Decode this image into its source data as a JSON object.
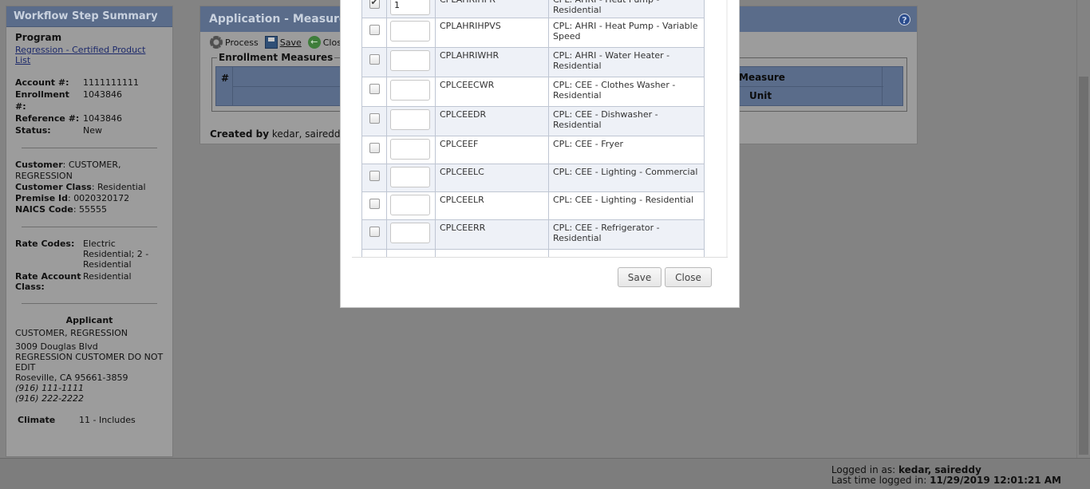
{
  "left_panel": {
    "title": "Workflow Step Summary",
    "program_label": "Program",
    "program_link": "Regression - Certified Product List",
    "account_label": "Account #:",
    "account_value": "1111111111",
    "enrollment_label": "Enrollment #:",
    "enrollment_value": "1043846",
    "reference_label": "Reference #:",
    "reference_value": "1043846",
    "status_label": "Status:",
    "status_value": "New",
    "customer_label": "Customer",
    "customer_value": "CUSTOMER, REGRESSION",
    "customer_class_label": "Customer Class",
    "customer_class_value": "Residential",
    "premise_label": "Premise Id",
    "premise_value": "0020320172",
    "naics_label": "NAICS Code",
    "naics_value": "55555",
    "rate_codes_label": "Rate Codes:",
    "rate_codes_value": "Electric Residential; 2 - Residential",
    "rate_account_label": "Rate Account Class:",
    "rate_account_value": "Residential",
    "applicant_title": "Applicant",
    "applicant_name": "CUSTOMER, REGRESSION",
    "address_1": "3009 Douglas Blvd",
    "address_2": "REGRESSION CUSTOMER DO NOT EDIT",
    "address_3": "Roseville, CA 95661-3859",
    "phone_1": "(916) 111-1111",
    "phone_2": "(916) 222-2222",
    "climate_label": "Climate",
    "climate_value": "11 - Includes"
  },
  "app_panel": {
    "title": "Application - Measures - ",
    "help": "?",
    "toolbar": {
      "process": "Process",
      "save": "Save",
      "close": "Close"
    },
    "enrollment_legend": "Enrollment Measures",
    "col_hash": "#",
    "col_measure": "Measure",
    "col_unit": "Unit",
    "created_label": "Created by",
    "created_value": "kedar, saireddy o"
  },
  "modal": {
    "rows": [
      {
        "checked": true,
        "qty": "1",
        "code": "CPLAHRIHPR",
        "desc": "CPL: AHRI - Heat Pump - Residential"
      },
      {
        "checked": false,
        "qty": "",
        "code": "CPLAHRIHPVS",
        "desc": "CPL: AHRI - Heat Pump - Variable Speed"
      },
      {
        "checked": false,
        "qty": "",
        "code": "CPLAHRIWHR",
        "desc": "CPL: AHRI - Water Heater - Residential"
      },
      {
        "checked": false,
        "qty": "",
        "code": "CPLCEECWR",
        "desc": "CPL: CEE - Clothes Washer - Residential"
      },
      {
        "checked": false,
        "qty": "",
        "code": "CPLCEEDR",
        "desc": "CPL: CEE - Dishwasher - Residential"
      },
      {
        "checked": false,
        "qty": "",
        "code": "CPLCEEF",
        "desc": "CPL: CEE - Fryer"
      },
      {
        "checked": false,
        "qty": "",
        "code": "CPLCEELC",
        "desc": "CPL: CEE - Lighting - Commercial"
      },
      {
        "checked": false,
        "qty": "",
        "code": "CPLCEELR",
        "desc": "CPL: CEE - Lighting - Residential"
      },
      {
        "checked": false,
        "qty": "",
        "code": "CPLCEERR",
        "desc": "CPL: CEE - Refrigerator - Residential"
      }
    ],
    "save_label": "Save",
    "close_label": "Close"
  },
  "footer": {
    "logged_in_label": "Logged in as:",
    "logged_in_user": "kedar, saireddy",
    "last_time_label": "Last time logged in:",
    "last_time_value": "11/29/2019 12:01:21 AM"
  }
}
